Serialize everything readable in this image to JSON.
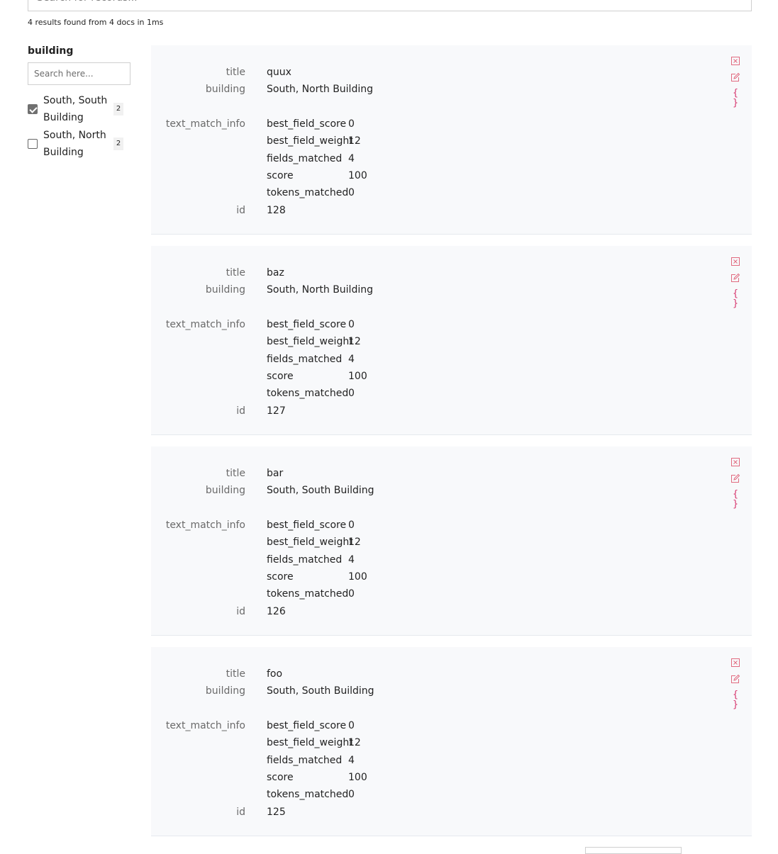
{
  "search": {
    "placeholder": "Search for records..."
  },
  "summary": "4 results found from 4 docs in 1ms",
  "facet": {
    "title": "building",
    "search_placeholder": "Search here...",
    "options": [
      {
        "label": "South, South Building",
        "count": "2",
        "checked": true
      },
      {
        "label": "South, North Building",
        "count": "2",
        "checked": false
      }
    ]
  },
  "field_labels": {
    "title": "title",
    "building": "building",
    "text_match_info": "text_match_info",
    "id": "id",
    "best_field_score": "best_field_score",
    "best_field_weight": "best_field_weight",
    "fields_matched": "fields_matched",
    "score": "score",
    "tokens_matched": "tokens_matched"
  },
  "hits": [
    {
      "title": "quux",
      "building": "South, North Building",
      "text_match_info": {
        "best_field_score": "0",
        "best_field_weight": "12",
        "fields_matched": "4",
        "score": "100",
        "tokens_matched": "0"
      },
      "id": "128"
    },
    {
      "title": "baz",
      "building": "South, North Building",
      "text_match_info": {
        "best_field_score": "0",
        "best_field_weight": "12",
        "fields_matched": "4",
        "score": "100",
        "tokens_matched": "0"
      },
      "id": "127"
    },
    {
      "title": "bar",
      "building": "South, South Building",
      "text_match_info": {
        "best_field_score": "0",
        "best_field_weight": "12",
        "fields_matched": "4",
        "score": "100",
        "tokens_matched": "0"
      },
      "id": "126"
    },
    {
      "title": "foo",
      "building": "South, South Building",
      "text_match_info": {
        "best_field_score": "0",
        "best_field_weight": "12",
        "fields_matched": "4",
        "score": "100",
        "tokens_matched": "0"
      },
      "id": "125"
    }
  ],
  "icons": {
    "delete": "delete-icon",
    "edit": "edit-icon",
    "json": "{ }"
  },
  "colors": {
    "accent": "#d6336c",
    "card_bg": "#f8f9fb",
    "icon_red": "#e16a7f"
  }
}
